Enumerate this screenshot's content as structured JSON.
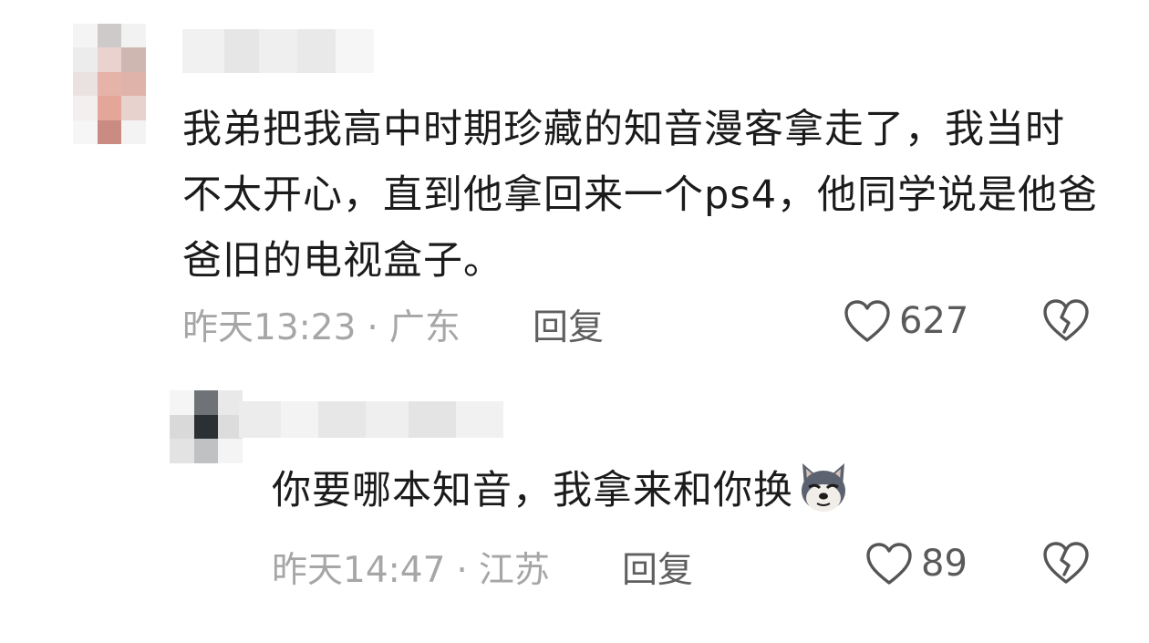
{
  "comments": [
    {
      "text": "我弟把我高中时期珍藏的知音漫客拿走了，我当时不太开心，直到他拿回来一个ps4，他同学说是他爸爸旧的电视盒子。",
      "time": "昨天13:23",
      "separator": "·",
      "location": "广东",
      "reply_label": "回复",
      "likes": "627",
      "avatar_icon": "blurred-avatar",
      "like_icon": "heart-outline-icon",
      "dislike_icon": "broken-heart-icon"
    },
    {
      "text": "你要哪本知音，我拿来和你换",
      "emoji": "doge-dog-emoji",
      "time": "昨天14:47",
      "separator": "·",
      "location": "江苏",
      "reply_label": "回复",
      "likes": "89",
      "avatar_icon": "blurred-avatar",
      "like_icon": "heart-outline-icon",
      "dislike_icon": "broken-heart-icon"
    }
  ],
  "colors": {
    "text": "#1b1b1b",
    "meta": "#a6a6a6",
    "action": "#5f5f5f",
    "icon": "#555555",
    "background": "#ffffff"
  }
}
